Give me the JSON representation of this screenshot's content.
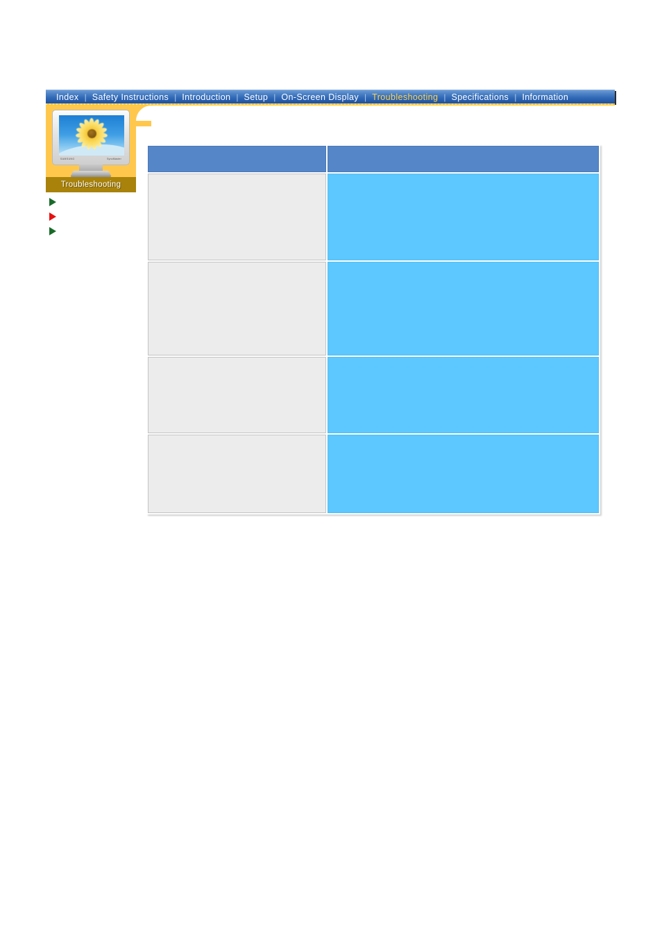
{
  "nav": {
    "separator": "|",
    "items": [
      {
        "label": "Index",
        "active": false
      },
      {
        "label": "Safety Instructions",
        "active": false
      },
      {
        "label": "Introduction",
        "active": false
      },
      {
        "label": "Setup",
        "active": false
      },
      {
        "label": "On-Screen Display",
        "active": false
      },
      {
        "label": "Troubleshooting",
        "active": true
      },
      {
        "label": "Specifications",
        "active": false
      },
      {
        "label": "Information",
        "active": false
      }
    ],
    "active_color": "#ffd24d",
    "bar_color": "#2f66b4",
    "underline_color": "#ffc83c"
  },
  "sidebar": {
    "panel_color": "#ffc84d",
    "section_label": "Troubleshooting",
    "section_label_bg": "#a8820a",
    "monitor": {
      "brand_left": "SAMSUNG",
      "brand_right": "SyncMaster",
      "wallpaper": "sunflower"
    },
    "links": [
      {
        "label": "",
        "bullet": "arrow-green",
        "color": "#1a6b2a"
      },
      {
        "label": "",
        "bullet": "arrow-red",
        "color": "#e81010"
      },
      {
        "label": "",
        "bullet": "arrow-green",
        "color": "#1a6b2a"
      }
    ]
  },
  "table": {
    "header_bg": "#5586c8",
    "symptom_bg": "#ececec",
    "checklist_bg": "#5cc8ff",
    "columns": [
      {
        "label": ""
      },
      {
        "label": ""
      }
    ],
    "rows": [
      {
        "symptom": "",
        "checklist": ""
      },
      {
        "symptom": "",
        "checklist": ""
      },
      {
        "symptom": "",
        "checklist": ""
      },
      {
        "symptom": "",
        "checklist": ""
      }
    ]
  }
}
